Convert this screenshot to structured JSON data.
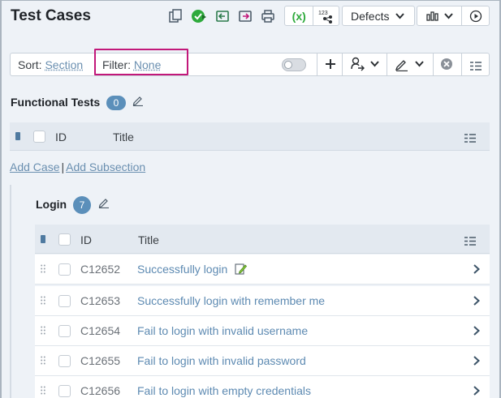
{
  "header": {
    "title": "Test Cases",
    "defects_label": "Defects",
    "formula_label": "(x)",
    "numbers_label": "123"
  },
  "filterbar": {
    "sort_label": "Sort:",
    "sort_value": "Section",
    "filter_label": "Filter:",
    "filter_value": "None"
  },
  "functional": {
    "title": "Functional Tests",
    "count": "0",
    "col_id": "ID",
    "col_title": "Title",
    "add_case": "Add Case",
    "separator": "|",
    "add_subsection": "Add Subsection"
  },
  "login": {
    "title": "Login",
    "count": "7",
    "col_id": "ID",
    "col_title": "Title",
    "rows": [
      {
        "id": "C12652",
        "title": "Successfully login"
      },
      {
        "id": "C12653",
        "title": "Successfully login with remember me"
      },
      {
        "id": "C12654",
        "title": "Fail to login with invalid username"
      },
      {
        "id": "C12655",
        "title": "Fail to login with invalid password"
      },
      {
        "id": "C12656",
        "title": "Fail to login with empty credentials"
      }
    ]
  },
  "colors": {
    "accent": "#5b8fba",
    "link": "#5d8ab2",
    "highlight": "#c2187a",
    "green": "#2eaa3c"
  }
}
